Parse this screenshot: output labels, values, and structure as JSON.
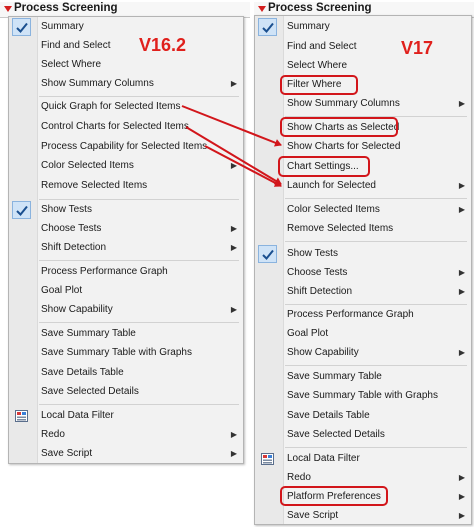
{
  "menus": {
    "v16": {
      "title": "Process Screening",
      "version_label": "V16.2",
      "items": [
        {
          "label": "Summary",
          "submenu": false,
          "checked": true
        },
        {
          "label": "Find and Select",
          "submenu": false
        },
        {
          "label": "Select Where",
          "submenu": false
        },
        {
          "label": "Show Summary Columns",
          "submenu": true
        },
        {
          "label": "Quick Graph for Selected Items",
          "submenu": false
        },
        {
          "label": "Control Charts for Selected Items",
          "submenu": false
        },
        {
          "label": "Process Capability for Selected Items",
          "submenu": false
        },
        {
          "label": "Color Selected Items",
          "submenu": true
        },
        {
          "label": "Remove Selected Items",
          "submenu": false
        },
        {
          "label": "Show Tests",
          "submenu": false,
          "checked": true
        },
        {
          "label": "Choose Tests",
          "submenu": true
        },
        {
          "label": "Shift Detection",
          "submenu": true
        },
        {
          "label": "Process Performance Graph",
          "submenu": false
        },
        {
          "label": "Goal Plot",
          "submenu": false
        },
        {
          "label": "Show Capability",
          "submenu": true
        },
        {
          "label": "Save Summary Table",
          "submenu": false
        },
        {
          "label": "Save Summary Table with Graphs",
          "submenu": false
        },
        {
          "label": "Save Details Table",
          "submenu": false
        },
        {
          "label": "Save Selected Details",
          "submenu": false
        },
        {
          "label": "Local Data Filter",
          "submenu": false,
          "icon": "data-filter-icon"
        },
        {
          "label": "Redo",
          "submenu": true
        },
        {
          "label": "Save Script",
          "submenu": true
        }
      ]
    },
    "v17": {
      "title": "Process Screening",
      "version_label": "V17",
      "items": [
        {
          "label": "Summary",
          "submenu": false,
          "checked": true
        },
        {
          "label": "Find and Select",
          "submenu": false
        },
        {
          "label": "Select Where",
          "submenu": false
        },
        {
          "label": "Filter Where",
          "submenu": false,
          "highlighted": true
        },
        {
          "label": "Show Summary Columns",
          "submenu": true
        },
        {
          "label": "Show Charts as Selected",
          "submenu": false,
          "highlighted": true
        },
        {
          "label": "Show Charts for Selected",
          "submenu": false
        },
        {
          "label": "Chart Settings...",
          "submenu": false,
          "highlighted": true
        },
        {
          "label": "Launch for Selected",
          "submenu": true
        },
        {
          "label": "Color Selected Items",
          "submenu": true
        },
        {
          "label": "Remove Selected Items",
          "submenu": false
        },
        {
          "label": "Show Tests",
          "submenu": false,
          "checked": true
        },
        {
          "label": "Choose Tests",
          "submenu": true
        },
        {
          "label": "Shift Detection",
          "submenu": true
        },
        {
          "label": "Process Performance Graph",
          "submenu": false
        },
        {
          "label": "Goal Plot",
          "submenu": false
        },
        {
          "label": "Show Capability",
          "submenu": true
        },
        {
          "label": "Save Summary Table",
          "submenu": false
        },
        {
          "label": "Save Summary Table with Graphs",
          "submenu": false
        },
        {
          "label": "Save Details Table",
          "submenu": false
        },
        {
          "label": "Save Selected Details",
          "submenu": false
        },
        {
          "label": "Local Data Filter",
          "submenu": false,
          "icon": "data-filter-icon"
        },
        {
          "label": "Redo",
          "submenu": true
        },
        {
          "label": "Platform Preferences",
          "submenu": true,
          "highlighted": true
        },
        {
          "label": "Save Script",
          "submenu": true
        }
      ]
    }
  },
  "icons": {
    "submenu_arrow": "chevron-right-icon",
    "check": "checkmark-icon",
    "title_triangle": "red-disclosure-triangle-icon"
  },
  "colors": {
    "annotation_red": "#d2161b",
    "check_bg": "#cfe3f7",
    "menu_bg": "#f2f2f2"
  }
}
